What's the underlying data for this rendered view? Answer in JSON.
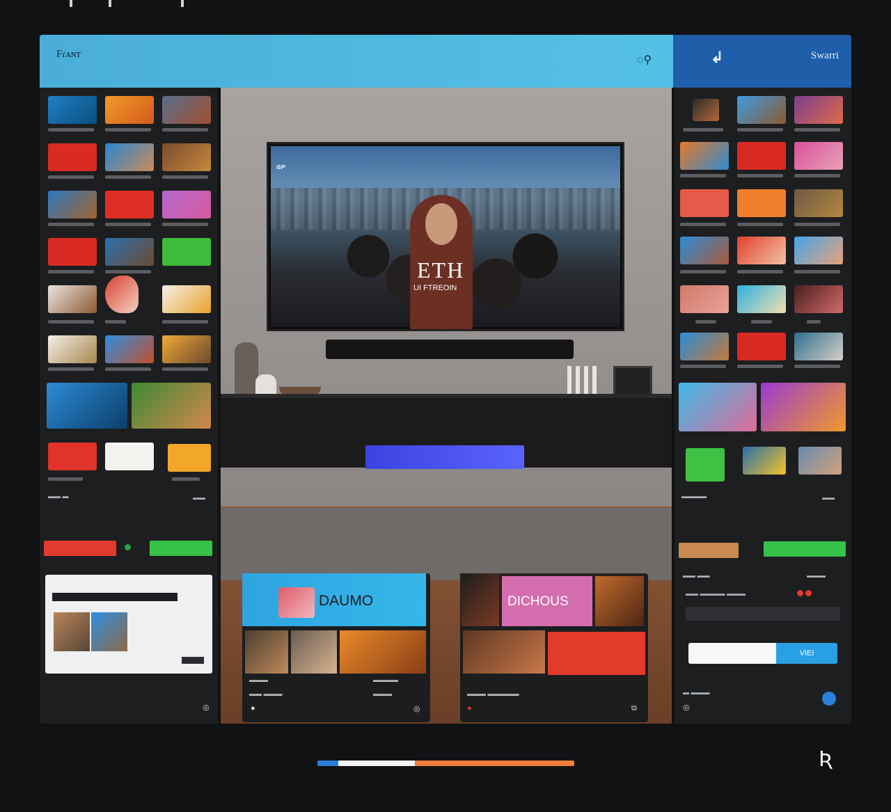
{
  "header": {
    "app_title": "Fɾᴀɴᴛ",
    "app_sub": "",
    "user_label": "Swarri"
  },
  "tv": {
    "logo": "ɢᴘ",
    "title": "ETH",
    "subtitle": "UI FTREOIN"
  },
  "left": {
    "delete_button": "",
    "confirm_button": "",
    "footer_left": "",
    "footer_right": ""
  },
  "cards": [
    {
      "hero_label": "DAUMO"
    },
    {
      "hero_label": "DICHOUS",
      "promo_label": ""
    }
  ],
  "right": {
    "btn_left": "",
    "btn_right": "",
    "input_value": "",
    "search_button": "VIEI"
  },
  "progress": {
    "segments": [
      0.08,
      0.3,
      0.62
    ]
  },
  "colors": {
    "accent_blue": "#4aaed8",
    "header_right": "#1f5ea9",
    "red": "#e23a2d",
    "green": "#37c24a",
    "orange": "#f07f3b"
  }
}
